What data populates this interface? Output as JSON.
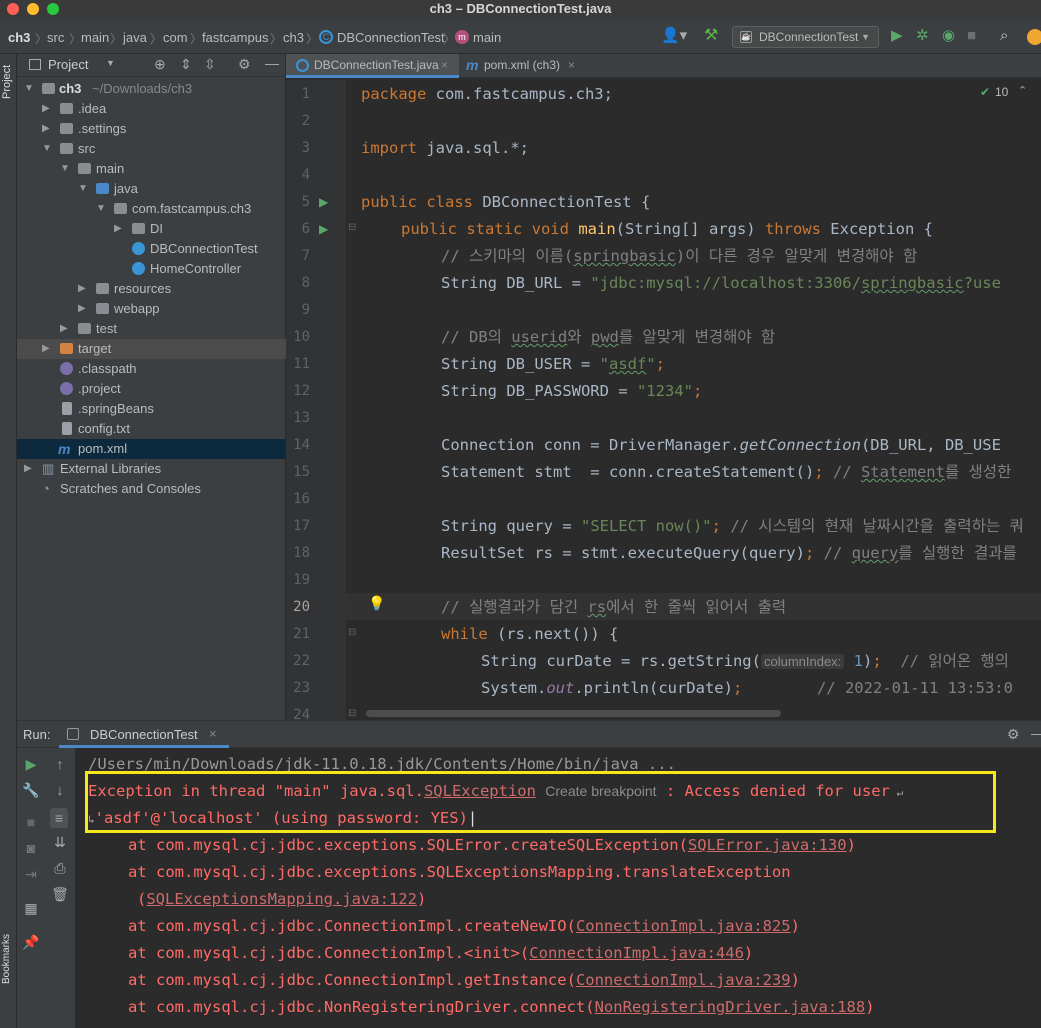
{
  "window": {
    "title": "ch3 – DBConnectionTest.java"
  },
  "breadcrumbs": [
    "ch3",
    "src",
    "main",
    "java",
    "com",
    "fastcampus",
    "ch3",
    "DBConnectionTest",
    "main"
  ],
  "run_config": {
    "label": "DBConnectionTest"
  },
  "project_panel": {
    "title": "Project",
    "tree": [
      {
        "label": "ch3",
        "extra": "~/Downloads/ch3"
      },
      {
        "label": ".idea"
      },
      {
        "label": ".settings"
      },
      {
        "label": "src"
      },
      {
        "label": "main"
      },
      {
        "label": "java"
      },
      {
        "label": "com.fastcampus.ch3"
      },
      {
        "label": "DI"
      },
      {
        "label": "DBConnectionTest"
      },
      {
        "label": "HomeController"
      },
      {
        "label": "resources"
      },
      {
        "label": "webapp"
      },
      {
        "label": "test"
      },
      {
        "label": "target"
      },
      {
        "label": ".classpath"
      },
      {
        "label": ".project"
      },
      {
        "label": ".springBeans"
      },
      {
        "label": "config.txt"
      },
      {
        "label": "pom.xml"
      },
      {
        "label": "External Libraries"
      },
      {
        "label": "Scratches and Consoles"
      }
    ]
  },
  "side_labels": {
    "project": "Project",
    "bookmarks": "Bookmarks"
  },
  "tabs": [
    {
      "label": "DBConnectionTest.java"
    },
    {
      "label": "pom.xml (ch3)"
    }
  ],
  "editor": {
    "inspection_count": "10",
    "line_numbers": [
      "1",
      "2",
      "3",
      "4",
      "5",
      "6",
      "7",
      "8",
      "9",
      "10",
      "11",
      "12",
      "13",
      "14",
      "15",
      "16",
      "17",
      "18",
      "19",
      "20",
      "21",
      "22",
      "23",
      "24"
    ],
    "code": {
      "l1_kw": "package",
      "l1_rest": " com.fastcampus.ch3;",
      "l3_kw": "import",
      "l3_rest": " java.sql.*;",
      "l5_kw": "public class",
      "l5_rest": " DBConnectionTest {",
      "l6_kw": "public static void",
      "l6_fn": "main",
      "l6_mid": "(String[] args) ",
      "l6_kw2": "throws",
      "l6_end": " Exception {",
      "l7_cm1": "// 스키마의 이름(",
      "l7_cm2": "springbasic",
      "l7_cm3": ")이 다른 경우 알맞게 변경해야 함",
      "l8_a": "String DB_URL = ",
      "l8_s1": "\"jdbc:mysql://localhost:3306/",
      "l8_s2": "springbasic",
      "l8_s3": "?use",
      "l10_cm1": "// DB의 ",
      "l10_cm2": "userid",
      "l10_cm3": "와 ",
      "l10_cm4": "pwd",
      "l10_cm5": "를 알맞게 변경해야 함",
      "l11_a": "String DB_USER = ",
      "l11_q1": "\"",
      "l11_s": "asdf",
      "l11_q2": "\"",
      "l11_end": ";",
      "l12_a": "String DB_PASSWORD = ",
      "l12_s": "\"1234\"",
      "l12_end": ";",
      "l14_a": "Connection conn = DriverManager.",
      "l14_it": "getConnection",
      "l14_end": "(DB_URL, DB_USE",
      "l15_a": "Statement stmt  = conn.createStatement()",
      "l15_semi": ";",
      "l15_cm1": " // ",
      "l15_cm2": "Statement",
      "l15_cm3": "를 생성한",
      "l17_a": "String query = ",
      "l17_s": "\"SELECT now()\"",
      "l17_semi": ";",
      "l17_cm": " // 시스템의 현재 날짜시간을 출력하는 쿼",
      "l18_a": "ResultSet rs = stmt.executeQuery(query)",
      "l18_semi": ";",
      "l18_cm1": " // ",
      "l18_cm2": "query",
      "l18_cm3": "를 실행한 결과를",
      "l20_cm1": "// 실행결과가 담긴 ",
      "l20_cm2": "rs",
      "l20_cm3": "에서 한 줄씩 읽어서 출력",
      "l21_kw": "while",
      "l21_rest": " (rs.next()) {",
      "l22_a": "String curDate = rs.getString(",
      "l22_hint": "columnIndex:",
      "l22_num": " 1",
      "l22_end": ")",
      "l22_semi": ";",
      "l22_cm": "  // 읽어온 행의",
      "l23_a": "System.",
      "l23_fld": "out",
      "l23_b": ".println(curDate)",
      "l23_semi": ";",
      "l23_cm": "        // 2022-01-11 13:53:0"
    }
  },
  "run_panel": {
    "label": "Run:",
    "tab": "DBConnectionTest",
    "console": {
      "cmd": "/Users/min/Downloads/jdk-11.0.18.jdk/Contents/Home/bin/java ...",
      "exc_a": "Exception in thread \"main\" java.sql.",
      "exc_link": "SQLException",
      "exc_badge": "Create breakpoint",
      "exc_b": ": Access denied for user",
      "exc_c": "'asdf'@'localhost' (using password: YES)",
      "trace": [
        {
          "pre": "at com.mysql.cj.jdbc.exceptions.SQLError.createSQLException(",
          "link": "SQLError.java:130",
          "post": ")"
        },
        {
          "pre": "at com.mysql.cj.jdbc.exceptions.SQLExceptionsMapping.translateException",
          "link": "",
          "post": ""
        },
        {
          "pre": "(",
          "link": "SQLExceptionsMapping.java:122",
          "post": ")"
        },
        {
          "pre": "at com.mysql.cj.jdbc.ConnectionImpl.createNewIO(",
          "link": "ConnectionImpl.java:825",
          "post": ")"
        },
        {
          "pre": "at com.mysql.cj.jdbc.ConnectionImpl.<init>(",
          "link": "ConnectionImpl.java:446",
          "post": ")"
        },
        {
          "pre": "at com.mysql.cj.jdbc.ConnectionImpl.getInstance(",
          "link": "ConnectionImpl.java:239",
          "post": ")"
        },
        {
          "pre": "at com.mysql.cj.jdbc.NonRegisteringDriver.connect(",
          "link": "NonRegisteringDriver.java:188",
          "post": ")"
        }
      ]
    }
  },
  "colors": {
    "accent": "#4a88c7",
    "error": "#ff6b68",
    "highlight_box": "#f5e71a"
  }
}
